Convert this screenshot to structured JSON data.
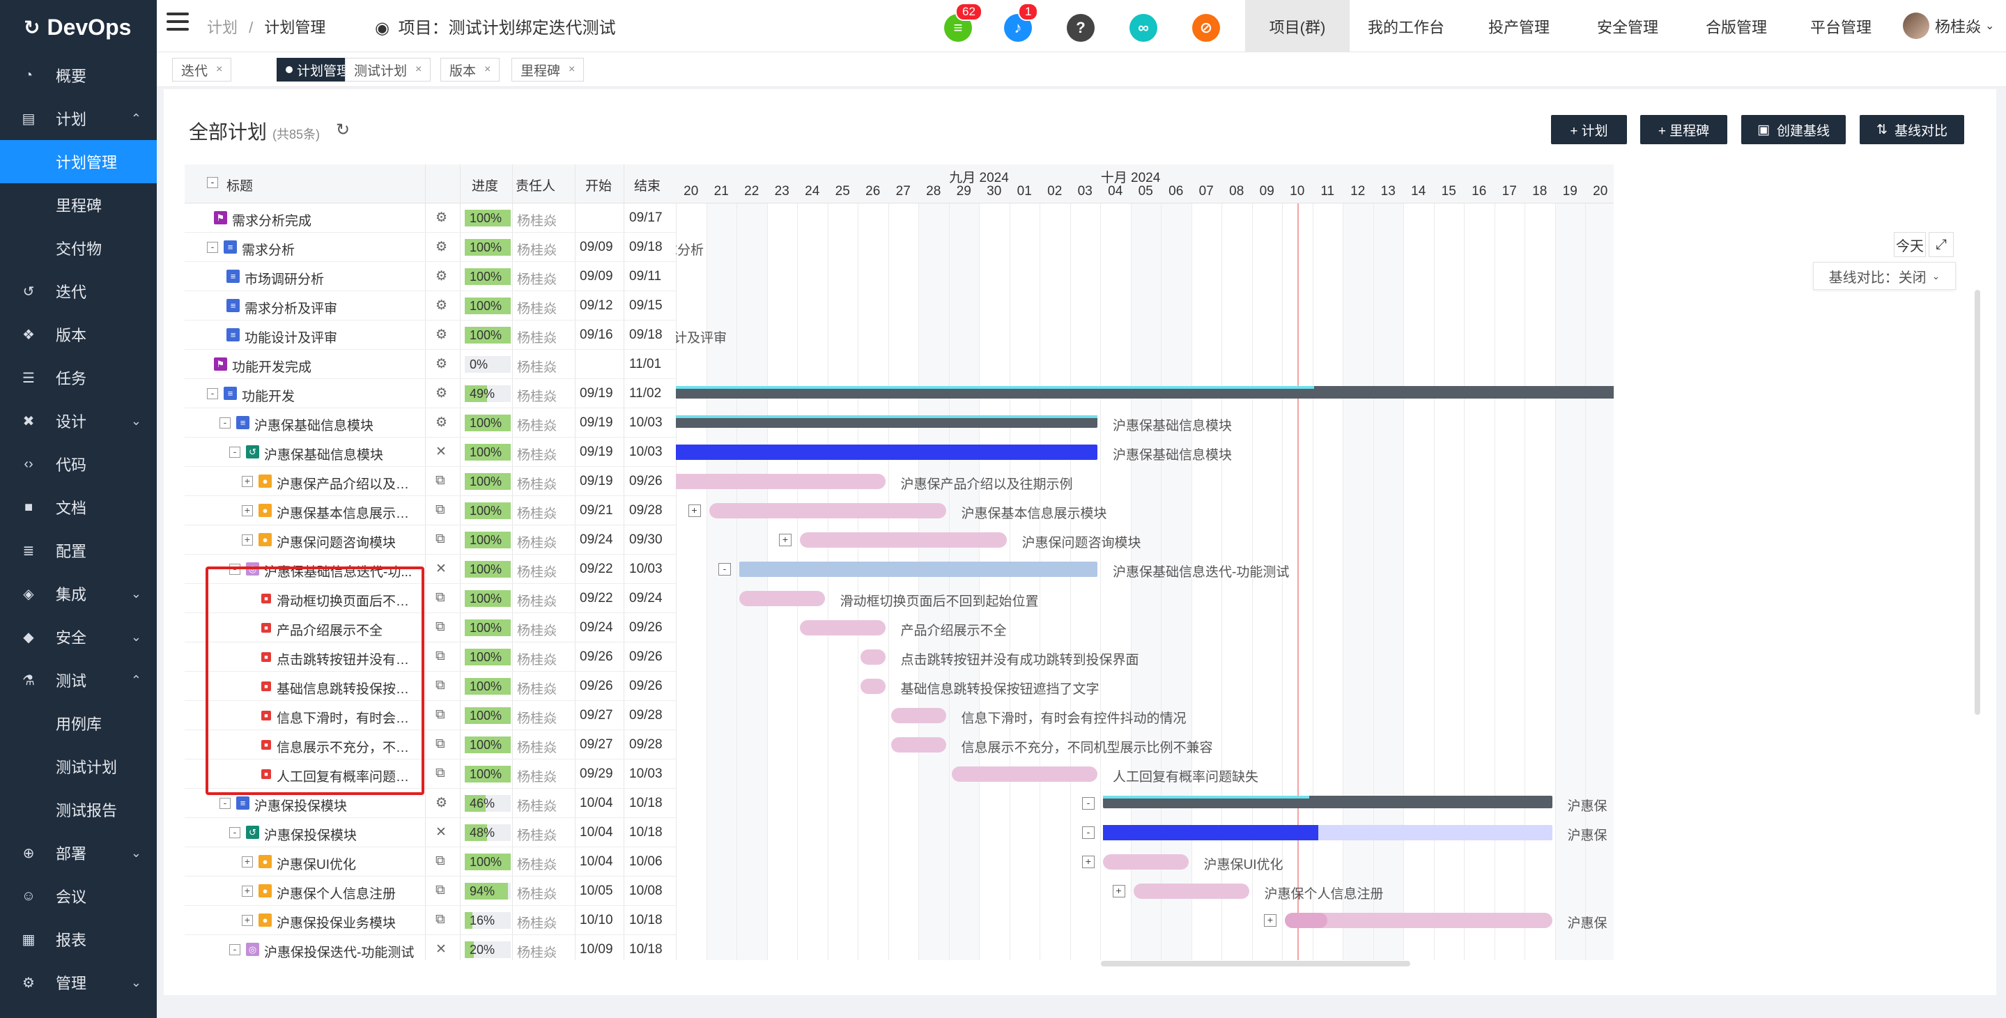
{
  "brand": "DevOps",
  "sidebar": [
    {
      "label": "概要",
      "icon": "dashboard-icon",
      "chev": ""
    },
    {
      "label": "计划",
      "icon": "plan-icon",
      "chev": "^"
    },
    {
      "label": "计划管理",
      "sub": true,
      "active": true
    },
    {
      "label": "里程碑",
      "sub": true
    },
    {
      "label": "交付物",
      "sub": true
    },
    {
      "label": "迭代",
      "icon": "iteration-icon",
      "chev": ""
    },
    {
      "label": "版本",
      "icon": "version-icon",
      "chev": ""
    },
    {
      "label": "任务",
      "icon": "task-icon",
      "chev": ""
    },
    {
      "label": "设计",
      "icon": "design-icon",
      "chev": "v"
    },
    {
      "label": "代码",
      "icon": "code-icon",
      "chev": ""
    },
    {
      "label": "文档",
      "icon": "doc-icon",
      "chev": ""
    },
    {
      "label": "配置",
      "icon": "config-icon",
      "chev": ""
    },
    {
      "label": "集成",
      "icon": "integration-icon",
      "chev": "v"
    },
    {
      "label": "安全",
      "icon": "shield-icon",
      "chev": "v"
    },
    {
      "label": "测试",
      "icon": "flask-icon",
      "chev": "^"
    },
    {
      "label": "用例库",
      "sub": true
    },
    {
      "label": "测试计划",
      "sub": true
    },
    {
      "label": "测试报告",
      "sub": true
    },
    {
      "label": "部署",
      "icon": "deploy-icon",
      "chev": "v"
    },
    {
      "label": "会议",
      "icon": "meeting-icon",
      "chev": ""
    },
    {
      "label": "报表",
      "icon": "report-icon",
      "chev": ""
    },
    {
      "label": "管理",
      "icon": "gear-icon",
      "chev": "v"
    }
  ],
  "topbar": {
    "crumb_root": "计划",
    "crumb_sep": "/",
    "crumb_current": "计划管理",
    "project_title": "项目：测试计划绑定迭代测试",
    "badges": {
      "doc": "62",
      "bell": "1"
    },
    "nav": [
      "项目(群)",
      "我的工作台",
      "投产管理",
      "安全管理",
      "合版管理",
      "平台管理"
    ],
    "user": "杨桂焱"
  },
  "tabs": [
    {
      "label": "迭代",
      "active": false
    },
    {
      "label": "计划管理",
      "active": true
    },
    {
      "label": "测试计划",
      "active": false
    },
    {
      "label": "版本",
      "active": false
    },
    {
      "label": "里程碑",
      "active": false
    }
  ],
  "panel": {
    "title": "全部计划",
    "count": "(共85条)",
    "buttons": [
      "+ 计划",
      "+ 里程碑",
      "创建基线",
      "基线对比"
    ],
    "today": "今天",
    "baseline_compare": "基线对比：关闭"
  },
  "grid_header": {
    "title": "标题",
    "progress": "进度",
    "owner": "责任人",
    "start": "开始",
    "end": "结束"
  },
  "rows": [
    {
      "title": "需求分析完成",
      "indent": 1,
      "tog": "",
      "type": "milestone",
      "op": "gear",
      "prog": "100%",
      "pv": 1.0,
      "owner": "杨桂焱",
      "start": "",
      "end": "09/17"
    },
    {
      "title": "需求分析",
      "indent": 1,
      "tog": "-",
      "type": "plan",
      "op": "gear",
      "prog": "100%",
      "pv": 1.0,
      "owner": "杨桂焱",
      "start": "09/09",
      "end": "09/18"
    },
    {
      "title": "市场调研分析",
      "indent": 2,
      "tog": "",
      "type": "plan",
      "op": "gear",
      "prog": "100%",
      "pv": 1.0,
      "owner": "杨桂焱",
      "start": "09/09",
      "end": "09/11"
    },
    {
      "title": "需求分析及评审",
      "indent": 2,
      "tog": "",
      "type": "plan",
      "op": "gear",
      "prog": "100%",
      "pv": 1.0,
      "owner": "杨桂焱",
      "start": "09/12",
      "end": "09/15"
    },
    {
      "title": "功能设计及评审",
      "indent": 2,
      "tog": "",
      "type": "plan",
      "op": "gear",
      "prog": "100%",
      "pv": 1.0,
      "owner": "杨桂焱",
      "start": "09/16",
      "end": "09/18"
    },
    {
      "title": "功能开发完成",
      "indent": 1,
      "tog": "",
      "type": "milestone",
      "op": "gear",
      "prog": "0%",
      "pv": 0.0,
      "owner": "杨桂焱",
      "start": "",
      "end": "11/01"
    },
    {
      "title": "功能开发",
      "indent": 1,
      "tog": "-",
      "type": "plan",
      "op": "gear",
      "prog": "49%",
      "pv": 0.49,
      "owner": "杨桂焱",
      "start": "09/19",
      "end": "11/02"
    },
    {
      "title": "沪惠保基础信息模块",
      "indent": 2,
      "tog": "-",
      "type": "plan",
      "op": "gear",
      "prog": "100%",
      "pv": 1.0,
      "owner": "杨桂焱",
      "start": "09/19",
      "end": "10/03"
    },
    {
      "title": "沪惠保基础信息模块",
      "indent": 3,
      "tog": "-",
      "type": "iter",
      "op": "x",
      "prog": "100%",
      "pv": 1.0,
      "owner": "杨桂焱",
      "start": "09/19",
      "end": "10/03"
    },
    {
      "title": "沪惠保产品介绍以及往...",
      "indent": 4,
      "tog": "+",
      "type": "req",
      "op": "copy",
      "prog": "100%",
      "pv": 1.0,
      "owner": "杨桂焱",
      "start": "09/19",
      "end": "09/26"
    },
    {
      "title": "沪惠保基本信息展示模块",
      "indent": 4,
      "tog": "+",
      "type": "req",
      "op": "copy",
      "prog": "100%",
      "pv": 1.0,
      "owner": "杨桂焱",
      "start": "09/21",
      "end": "09/28"
    },
    {
      "title": "沪惠保问题咨询模块",
      "indent": 4,
      "tog": "+",
      "type": "req",
      "op": "copy",
      "prog": "100%",
      "pv": 1.0,
      "owner": "杨桂焱",
      "start": "09/24",
      "end": "09/30"
    },
    {
      "title": "沪惠保基础信息迭代-功...",
      "indent": 3,
      "tog": "-",
      "type": "test",
      "op": "x",
      "prog": "100%",
      "pv": 1.0,
      "owner": "杨桂焱",
      "start": "09/22",
      "end": "10/03"
    },
    {
      "title": "滑动框切换页面后不回...",
      "indent": 5,
      "tog": "",
      "type": "bug",
      "op": "copy",
      "prog": "100%",
      "pv": 1.0,
      "owner": "杨桂焱",
      "start": "09/22",
      "end": "09/24"
    },
    {
      "title": "产品介绍展示不全",
      "indent": 5,
      "tog": "",
      "type": "bug",
      "op": "copy",
      "prog": "100%",
      "pv": 1.0,
      "owner": "杨桂焱",
      "start": "09/24",
      "end": "09/26"
    },
    {
      "title": "点击跳转按钮并没有成...",
      "indent": 5,
      "tog": "",
      "type": "bug",
      "op": "copy",
      "prog": "100%",
      "pv": 1.0,
      "owner": "杨桂焱",
      "start": "09/26",
      "end": "09/26"
    },
    {
      "title": "基础信息跳转投保按钮...",
      "indent": 5,
      "tog": "",
      "type": "bug",
      "op": "copy",
      "prog": "100%",
      "pv": 1.0,
      "owner": "杨桂焱",
      "start": "09/26",
      "end": "09/26"
    },
    {
      "title": "信息下滑时，有时会有...",
      "indent": 5,
      "tog": "",
      "type": "bug",
      "op": "copy",
      "prog": "100%",
      "pv": 1.0,
      "owner": "杨桂焱",
      "start": "09/27",
      "end": "09/28"
    },
    {
      "title": "信息展示不充分，不同...",
      "indent": 5,
      "tog": "",
      "type": "bug",
      "op": "copy",
      "prog": "100%",
      "pv": 1.0,
      "owner": "杨桂焱",
      "start": "09/27",
      "end": "09/28"
    },
    {
      "title": "人工回复有概率问题缺失",
      "indent": 5,
      "tog": "",
      "type": "bug",
      "op": "copy",
      "prog": "100%",
      "pv": 1.0,
      "owner": "杨桂焱",
      "start": "09/29",
      "end": "10/03"
    },
    {
      "title": "沪惠保投保模块",
      "indent": 2,
      "tog": "-",
      "type": "plan",
      "op": "gear",
      "prog": "46%",
      "pv": 0.46,
      "owner": "杨桂焱",
      "start": "10/04",
      "end": "10/18"
    },
    {
      "title": "沪惠保投保模块",
      "indent": 3,
      "tog": "-",
      "type": "iter",
      "op": "x",
      "prog": "48%",
      "pv": 0.48,
      "owner": "杨桂焱",
      "start": "10/04",
      "end": "10/18"
    },
    {
      "title": "沪惠保UI优化",
      "indent": 4,
      "tog": "+",
      "type": "req",
      "op": "copy",
      "prog": "100%",
      "pv": 1.0,
      "owner": "杨桂焱",
      "start": "10/04",
      "end": "10/06"
    },
    {
      "title": "沪惠保个人信息注册",
      "indent": 4,
      "tog": "+",
      "type": "req",
      "op": "copy",
      "prog": "94%",
      "pv": 0.94,
      "owner": "杨桂焱",
      "start": "10/05",
      "end": "10/08"
    },
    {
      "title": "沪惠保投保业务模块",
      "indent": 4,
      "tog": "+",
      "type": "req",
      "op": "copy",
      "prog": "16%",
      "pv": 0.16,
      "owner": "杨桂焱",
      "start": "10/10",
      "end": "10/18"
    },
    {
      "title": "沪惠保投保迭代-功能测试",
      "indent": 3,
      "tog": "-",
      "type": "test",
      "op": "x",
      "prog": "20%",
      "pv": 0.2,
      "owner": "杨桂焱",
      "start": "10/09",
      "end": "10/18"
    }
  ],
  "gantt": {
    "months": [
      {
        "label": "九月 2024",
        "center_day": "2024-09-30"
      },
      {
        "label": "十月 2024",
        "center_day": "2024-10-05"
      }
    ],
    "days": [
      "20",
      "21",
      "22",
      "23",
      "24",
      "25",
      "26",
      "27",
      "28",
      "29",
      "30",
      "01",
      "02",
      "03",
      "04",
      "05",
      "06",
      "07",
      "08",
      "09",
      "10",
      "11",
      "12",
      "13",
      "14",
      "15",
      "16",
      "17",
      "18",
      "19",
      "20"
    ],
    "first_day": "2024-09-20",
    "today": "2024-10-10",
    "bars": [
      {
        "row": 1,
        "label": "需求分析",
        "style": "none",
        "start": null,
        "end": null
      },
      {
        "row": 4,
        "label": "功能设计及评审",
        "style": "none",
        "start": null,
        "end": null
      },
      {
        "row": 6,
        "label": "",
        "style": "gray",
        "start": "2024-09-19",
        "end": "2024-11-02",
        "progress": 0.49
      },
      {
        "row": 7,
        "label": "沪惠保基础信息模块",
        "style": "gray",
        "start": "2024-09-19",
        "end": "2024-10-03",
        "progress": 1.0
      },
      {
        "row": 8,
        "label": "沪惠保基础信息模块",
        "style": "blue",
        "start": "2024-09-19",
        "end": "2024-10-03"
      },
      {
        "row": 9,
        "label": "沪惠保产品介绍以及往期示例",
        "style": "pink",
        "start": "2024-09-19",
        "end": "2024-09-26"
      },
      {
        "row": 10,
        "label": "沪惠保基本信息展示模块",
        "style": "pink",
        "start": "2024-09-21",
        "end": "2024-09-28",
        "tog": "+"
      },
      {
        "row": 11,
        "label": "沪惠保问题咨询模块",
        "style": "pink",
        "start": "2024-09-24",
        "end": "2024-09-30",
        "tog": "+"
      },
      {
        "row": 12,
        "label": "沪惠保基础信息迭代-功能测试",
        "style": "light",
        "start": "2024-09-22",
        "end": "2024-10-03",
        "tog": "-"
      },
      {
        "row": 13,
        "label": "滑动框切换页面后不回到起始位置",
        "style": "pink",
        "start": "2024-09-22",
        "end": "2024-09-24"
      },
      {
        "row": 14,
        "label": "产品介绍展示不全",
        "style": "pink",
        "start": "2024-09-24",
        "end": "2024-09-26"
      },
      {
        "row": 15,
        "label": "点击跳转按钮并没有成功跳转到投保界面",
        "style": "pink",
        "start": "2024-09-26",
        "end": "2024-09-26"
      },
      {
        "row": 16,
        "label": "基础信息跳转投保按钮遮挡了文字",
        "style": "pink",
        "start": "2024-09-26",
        "end": "2024-09-26"
      },
      {
        "row": 17,
        "label": "信息下滑时，有时会有控件抖动的情况",
        "style": "pink",
        "start": "2024-09-27",
        "end": "2024-09-28"
      },
      {
        "row": 18,
        "label": "信息展示不充分，不同机型展示比例不兼容",
        "style": "pink",
        "start": "2024-09-27",
        "end": "2024-09-28"
      },
      {
        "row": 19,
        "label": "人工回复有概率问题缺失",
        "style": "pink",
        "start": "2024-09-29",
        "end": "2024-10-03"
      },
      {
        "row": 20,
        "label": "沪惠保",
        "style": "gray",
        "start": "2024-10-04",
        "end": "2024-10-18",
        "progress": 0.46,
        "tog": "-"
      },
      {
        "row": 21,
        "label": "沪惠保",
        "style": "blue",
        "start": "2024-10-04",
        "end": "2024-10-18",
        "progress": 0.48,
        "tog": "-"
      },
      {
        "row": 22,
        "label": "沪惠保UI优化",
        "style": "pink",
        "start": "2024-10-04",
        "end": "2024-10-06",
        "tog": "+"
      },
      {
        "row": 23,
        "label": "沪惠保个人信息注册",
        "style": "pink",
        "start": "2024-10-05",
        "end": "2024-10-08",
        "tog": "+"
      },
      {
        "row": 24,
        "label": "沪惠保",
        "style": "pink",
        "start": "2024-10-10",
        "end": "2024-10-18",
        "progress": 0.16,
        "tog": "+"
      }
    ]
  },
  "colors": {
    "sidebar": "#1f2d3d",
    "accent": "#1890ff",
    "progress": "#9ed47a",
    "bug": "#e53935",
    "req": "#f5a623",
    "plan": "#3f6ad8",
    "milestone": "#9c27b0",
    "iter": "#138a72"
  }
}
